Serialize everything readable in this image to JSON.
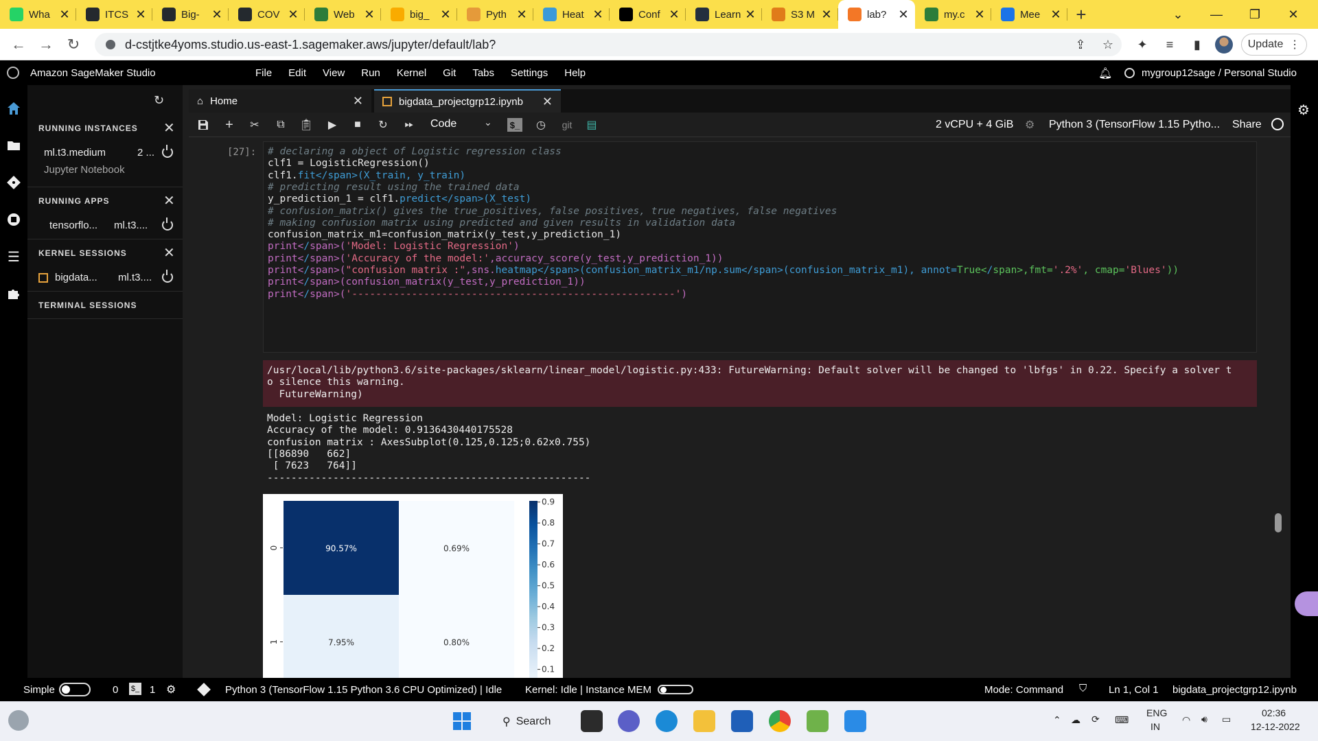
{
  "browser": {
    "tabs": [
      {
        "label": "Wha",
        "icon": "whatsapp-icon",
        "color": "#25d366"
      },
      {
        "label": "ITCS",
        "icon": "github-icon",
        "color": "#24292e"
      },
      {
        "label": "Big-",
        "icon": "github-icon",
        "color": "#24292e"
      },
      {
        "label": "COV",
        "icon": "github-icon",
        "color": "#24292e"
      },
      {
        "label": "Web",
        "icon": "evernote-icon",
        "color": "#2d7d3a"
      },
      {
        "label": "big_",
        "icon": "colab-icon",
        "color": "#f9ab00"
      },
      {
        "label": "Pyth",
        "icon": "python-icon",
        "color": "#e59a3a"
      },
      {
        "label": "Heat",
        "icon": "heatmap-icon",
        "color": "#3a9ad9"
      },
      {
        "label": "Conf",
        "icon": "medium-icon",
        "color": "#000000"
      },
      {
        "label": "Learn",
        "icon": "aws-icon",
        "color": "#232f3e"
      },
      {
        "label": "S3 M",
        "icon": "s3-icon",
        "color": "#e07b1a"
      },
      {
        "label": "lab?",
        "icon": "jupyter-icon",
        "color": "#f37726",
        "active": true
      },
      {
        "label": "my.c",
        "icon": "evernote-icon",
        "color": "#2d7d3a"
      },
      {
        "label": "Mee",
        "icon": "meet-icon",
        "color": "#1a73e8"
      }
    ],
    "url": "d-cstjtke4yoms.studio.us-east-1.sagemaker.aws/jupyter/default/lab?",
    "update_label": "Update"
  },
  "sagemaker": {
    "title": "Amazon SageMaker Studio",
    "menu": [
      "File",
      "Edit",
      "View",
      "Run",
      "Kernel",
      "Git",
      "Tabs",
      "Settings",
      "Help"
    ],
    "user": "mygroup12sage / Personal Studio"
  },
  "sidebar": {
    "running_instances": {
      "header": "RUNNING INSTANCES",
      "instance": "ml.t3.medium",
      "count": "2 ...",
      "sub": "Jupyter Notebook"
    },
    "running_apps": {
      "header": "RUNNING APPS",
      "app": "tensorflo...",
      "instance": "ml.t3...."
    },
    "kernel_sessions": {
      "header": "KERNEL SESSIONS",
      "name": "bigdata...",
      "instance": "ml.t3...."
    },
    "terminal_sessions": {
      "header": "TERMINAL SESSIONS"
    }
  },
  "doctabs": {
    "home": "Home",
    "notebook": "bigdata_projectgrp12.ipynb"
  },
  "toolbar": {
    "cell_type": "Code",
    "instance": "2 vCPU + 4 GiB",
    "kernel": "Python 3 (TensorFlow 1.15 Pytho...",
    "share": "Share",
    "git_label": "git"
  },
  "cell": {
    "prompt": "[27]:",
    "code": [
      "# declaring a object of Logistic regression class",
      "clf1 = LogisticRegression()",
      "clf1.fit(X_train, y_train)",
      "# predicting result using the trained data",
      "y_prediction_1 = clf1.predict(X_test)",
      "# confusion_matrix() gives the true_positives, false positives, true negatives, false negatives",
      "# making confusion matrix using predicted and given results in validation data",
      "confusion_matrix_m1=confusion_matrix(y_test,y_prediction_1)",
      "print('Model: Logistic Regression')",
      "print('Accuracy of the model:',accuracy_score(y_test,y_prediction_1))",
      "print(\"confusion matrix :\",sns.heatmap(confusion_matrix_m1/np.sum(confusion_matrix_m1), annot=True,fmt='.2%', cmap='Blues'))",
      "print(confusion_matrix(y_test,y_prediction_1))",
      "print('------------------------------------------------------')"
    ],
    "stderr": [
      "/usr/local/lib/python3.6/site-packages/sklearn/linear_model/logistic.py:433: FutureWarning: Default solver will be changed to 'lbfgs' in 0.22. Specify a solver t",
      "o silence this warning.",
      "  FutureWarning)"
    ],
    "stdout": [
      "Model: Logistic Regression",
      "Accuracy of the model: 0.9136430440175528",
      "confusion matrix : AxesSubplot(0.125,0.125;0.62x0.755)",
      "[[86890   662]",
      " [ 7623   764]]",
      "------------------------------------------------------"
    ]
  },
  "chart_data": {
    "type": "heatmap",
    "row_labels": [
      "0",
      "1"
    ],
    "col_labels": [
      "",
      ""
    ],
    "values": [
      [
        0.9057,
        0.0069
      ],
      [
        0.0795,
        0.008
      ]
    ],
    "annotations": [
      [
        "90.57%",
        "0.69%"
      ],
      [
        "7.95%",
        "0.80%"
      ]
    ],
    "colormap": "Blues",
    "colorbar_ticks": [
      "0.9",
      "0.8",
      "0.7",
      "0.6",
      "0.5",
      "0.4",
      "0.3",
      "0.2",
      "0.1"
    ],
    "colorbar_range": [
      0.0069,
      0.9057
    ]
  },
  "statusbar": {
    "simple": "Simple",
    "count_a": "0",
    "count_b": "1",
    "kernel_status": "Python 3 (TensorFlow 1.15 Python 3.6 CPU Optimized) | Idle",
    "kernel_idle": "Kernel: Idle | Instance MEM",
    "mode": "Mode: Command",
    "position": "Ln 1, Col 1",
    "filename": "bigdata_projectgrp12.ipynb"
  },
  "taskbar": {
    "search": "Search",
    "lang": "ENG",
    "region": "IN",
    "time": "02:36",
    "date": "12-12-2022"
  }
}
